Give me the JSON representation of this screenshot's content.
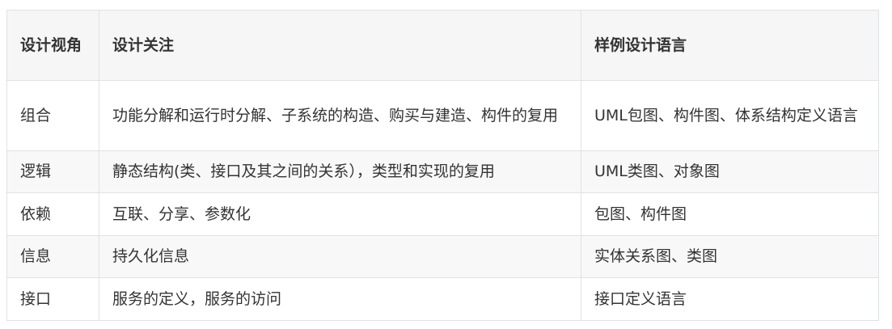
{
  "table": {
    "headers": [
      "设计视角",
      "设计关注",
      "样例设计语言"
    ],
    "rows": [
      [
        "组合",
        "功能分解和运行时分解、子系统的构造、购买与建造、构件的复用",
        "UML包图、构件图、体系结构定义语言"
      ],
      [
        "逻辑",
        "静态结构(类、接口及其之间的关系），类型和实现的复用",
        "UML类图、对象图"
      ],
      [
        "依赖",
        "互联、分享、参数化",
        "包图、构件图"
      ],
      [
        "信息",
        "持久化信息",
        "实体关系图、类图"
      ],
      [
        "接口",
        "服务的定义，服务的访问",
        "接口定义语言"
      ]
    ]
  }
}
